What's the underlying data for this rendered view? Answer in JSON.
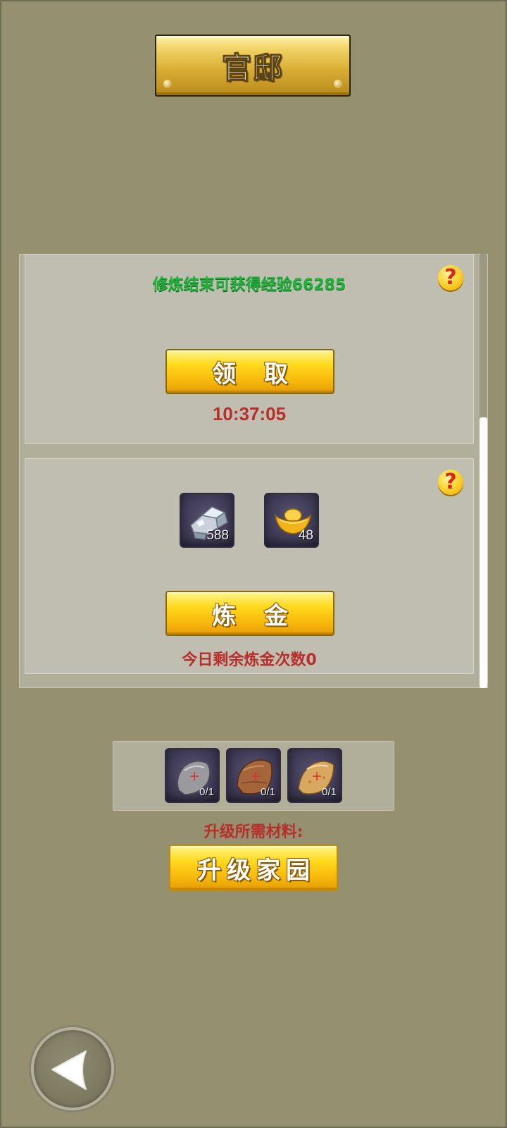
{
  "header": {
    "title": "官邸"
  },
  "experience_panel": {
    "info_text": "修炼结束可获得经验66285",
    "help_icon": "question-mark-icon",
    "claim_button_label": "领 取",
    "timer": "10:37:05"
  },
  "alchemy_panel": {
    "help_icon": "question-mark-icon",
    "items": [
      {
        "icon": "silver-ore-icon",
        "count": "588"
      },
      {
        "icon": "gold-ingot-icon",
        "count": "48"
      }
    ],
    "alchemy_button_label": "炼 金",
    "remaining_text": "今日剩余炼金次数0"
  },
  "upgrade": {
    "materials": [
      {
        "icon": "stone-material-icon",
        "count": "0/1"
      },
      {
        "icon": "wood-material-icon",
        "count": "0/1"
      },
      {
        "icon": "sand-material-icon",
        "count": "0/1"
      }
    ],
    "materials_label": "升级所需材料:",
    "upgrade_button_label": "升级家园"
  },
  "navigation": {
    "back_icon": "back-arrow-icon"
  },
  "colors": {
    "background": "#949070",
    "panel": "#c0beb1",
    "exp_text": "#1fb23a",
    "warning_text": "#b82e2a",
    "button_gold": "#ffd91c"
  }
}
